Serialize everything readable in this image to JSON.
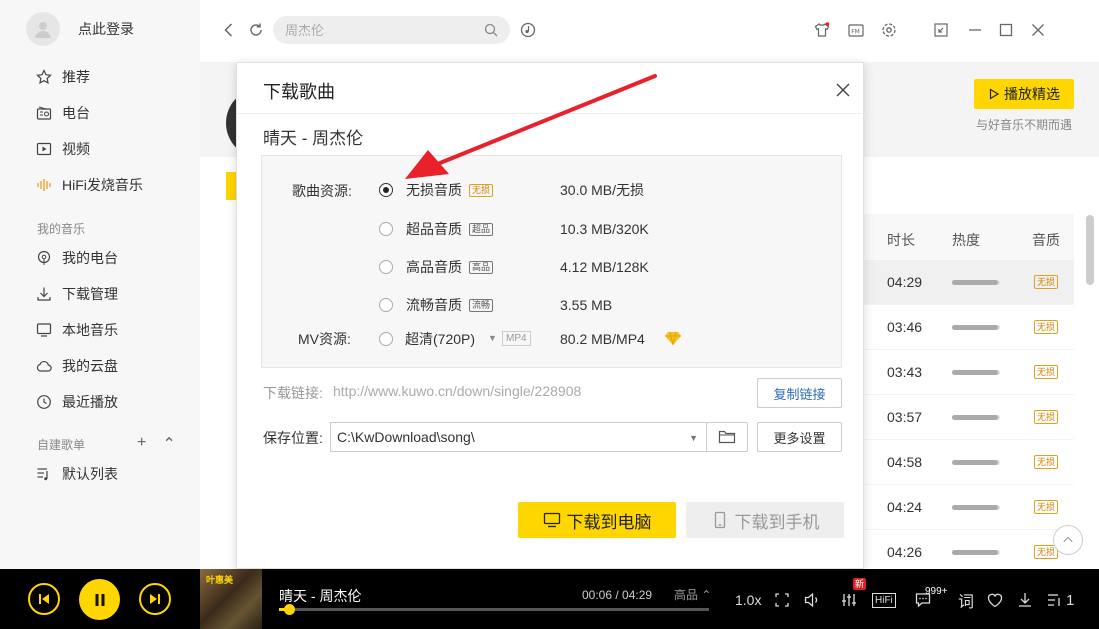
{
  "sidebar": {
    "login_text": "点此登录",
    "nav": [
      {
        "label": "推荐",
        "icon": "star-icon"
      },
      {
        "label": "电台",
        "icon": "radio-icon"
      },
      {
        "label": "视频",
        "icon": "video-icon"
      },
      {
        "label": "HiFi发烧音乐",
        "icon": "hifi-wave-icon"
      }
    ],
    "my_music_title": "我的音乐",
    "my_music": [
      {
        "label": "我的电台",
        "icon": "podcast-icon"
      },
      {
        "label": "下载管理",
        "icon": "download-icon"
      },
      {
        "label": "本地音乐",
        "icon": "monitor-icon"
      },
      {
        "label": "我的云盘",
        "icon": "cloud-icon"
      },
      {
        "label": "最近播放",
        "icon": "clock-icon"
      }
    ],
    "playlist_title": "自建歌单",
    "playlists": [
      {
        "label": "默认列表",
        "icon": "playlist-icon"
      }
    ]
  },
  "topbar": {
    "search_placeholder": "周杰伦"
  },
  "background": {
    "play_pick_label": "播放精选",
    "slogan": "与好音乐不期而遇",
    "columns": [
      "时长",
      "热度",
      "音质"
    ],
    "rows": [
      {
        "duration": "04:29",
        "quality": "无损",
        "heat": 0.95
      },
      {
        "duration": "03:46",
        "quality": "无损",
        "heat": 0.95
      },
      {
        "duration": "03:43",
        "quality": "无损",
        "heat": 0.95
      },
      {
        "duration": "03:57",
        "quality": "无损",
        "heat": 0.95
      },
      {
        "duration": "04:58",
        "quality": "无损",
        "heat": 0.95
      },
      {
        "duration": "04:24",
        "quality": "无损",
        "heat": 0.95
      },
      {
        "duration": "04:26",
        "quality": "无损",
        "heat": 0.95
      }
    ]
  },
  "dialog": {
    "title": "下载歌曲",
    "song": "晴天 - 周杰伦",
    "source_label": "歌曲资源:",
    "options": [
      {
        "name": "无损音质",
        "tag": "无损",
        "size": "30.0 MB/无损",
        "checked": true
      },
      {
        "name": "超品音质",
        "tag": "超品",
        "size": "10.3 MB/320K",
        "checked": false
      },
      {
        "name": "高品音质",
        "tag": "高品",
        "size": "4.12 MB/128K",
        "checked": false
      },
      {
        "name": "流畅音质",
        "tag": "流畅",
        "size": "3.55 MB",
        "checked": false
      }
    ],
    "mv_label": "MV资源:",
    "mv": {
      "name": "超清(720P)",
      "tag": "MP4",
      "size": "80.2 MB/MP4"
    },
    "link_label": "下载链接:",
    "link_url": "http://www.kuwo.cn/down/single/228908",
    "copy_button": "复制链接",
    "save_label": "保存位置:",
    "save_path": "C:\\KwDownload\\song\\",
    "more_settings": "更多设置",
    "download_pc": "下载到电脑",
    "download_phone": "下载到手机"
  },
  "player": {
    "title": "晴天 - 周杰伦",
    "time": "00:06 / 04:29",
    "quality": "高品",
    "progress": 0.023,
    "speed": "1.0x",
    "new_badge": "新",
    "hifi": "HiFi",
    "comments_badge": "999+",
    "lyrics": "词",
    "queue_count": "1",
    "cover_text": "叶惠美"
  },
  "colors": {
    "accent": "#ffd600",
    "annotation_arrow": "#e8212b",
    "quality_gold": "#d08000"
  }
}
